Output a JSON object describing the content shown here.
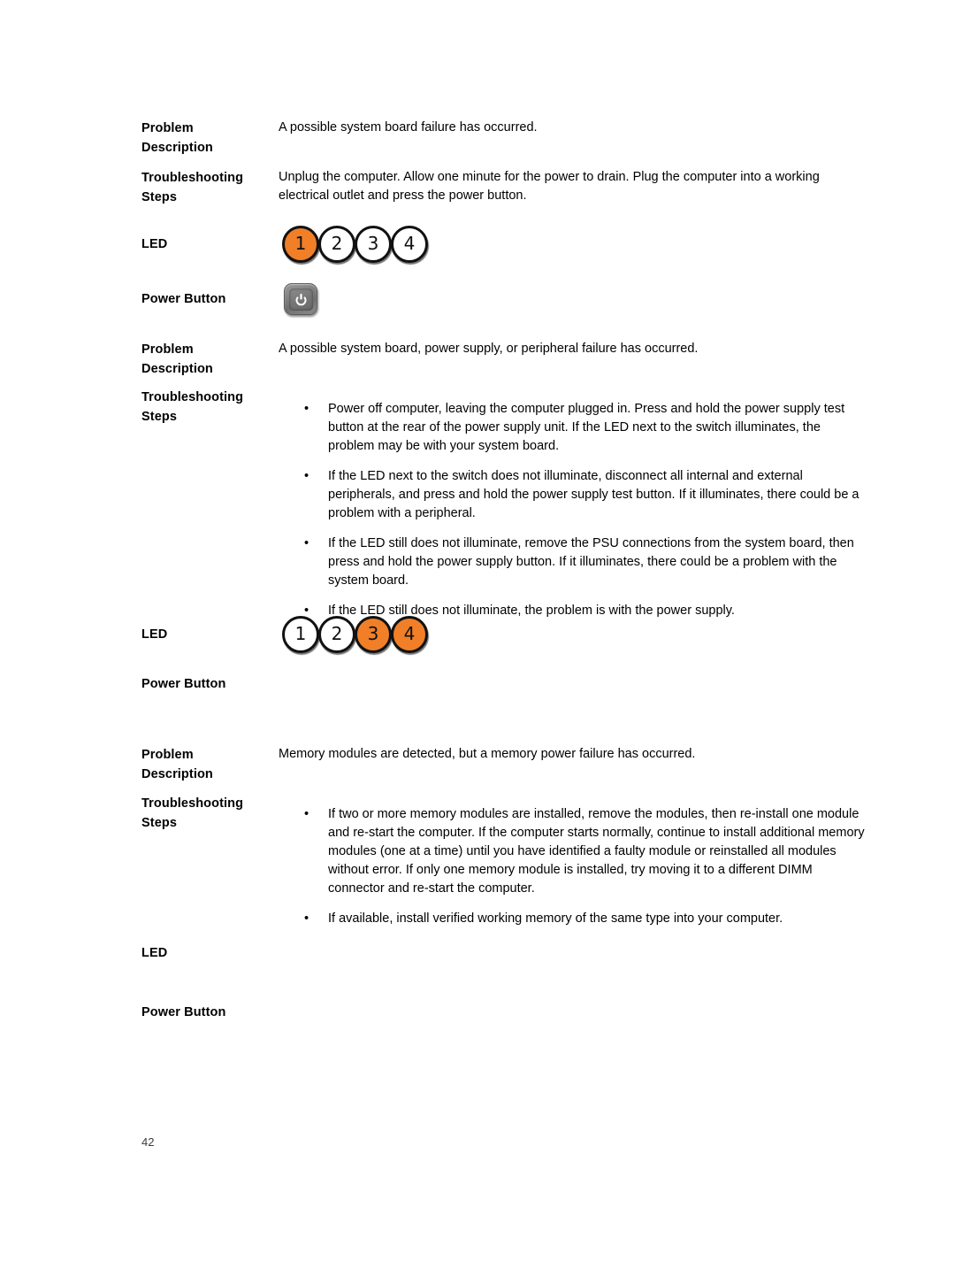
{
  "page": {
    "number": "42",
    "accent_orange": "#F07F28",
    "text_color": "#000000",
    "background": "#FFFFFF"
  },
  "labels": {
    "problem_description": "Problem\nDescription",
    "problem_line1": "Problem",
    "problem_line2": "Description",
    "troubleshooting_line1": "Troubleshooting",
    "troubleshooting_line2": "Steps",
    "led": "LED",
    "power_button": "Power Button"
  },
  "sections": [
    {
      "id": "section-1",
      "problem_description": "A possible system board failure has occurred.",
      "troubleshooting_paragraph": "Unplug the computer. Allow one minute for the power to drain. Plug the computer into a working electrical outlet and press the power button.",
      "troubleshooting_bullets": [],
      "led": {
        "bullet": "•",
        "lights": [
          {
            "number": "1",
            "state": "on"
          },
          {
            "number": "2",
            "state": "off"
          },
          {
            "number": "3",
            "state": "off"
          },
          {
            "number": "4",
            "state": "off"
          }
        ]
      },
      "power_button": {
        "icon": "power-button-icon",
        "visible": true
      }
    },
    {
      "id": "section-2",
      "problem_description": "A possible system board, power supply, or peripheral failure has occurred.",
      "troubleshooting_paragraph": "",
      "troubleshooting_bullets": [
        "Power off computer, leaving the computer plugged in. Press and hold the power supply test button at the rear of the power supply unit. If the LED next to the switch illuminates, the problem may be with your system board.",
        "If the LED next to the switch does not illuminate, disconnect all internal and external peripherals, and press and hold the power supply test button. If it illuminates, there could be a problem with a peripheral.",
        "If the LED still does not illuminate, remove the PSU connections from the system board, then press and hold the power supply button. If it illuminates, there could be a problem with the system board.",
        "If the LED still does not illuminate, the problem is with the power supply."
      ],
      "led": {
        "bullet": "•",
        "lights": [
          {
            "number": "1",
            "state": "off"
          },
          {
            "number": "2",
            "state": "off"
          },
          {
            "number": "3",
            "state": "on"
          },
          {
            "number": "4",
            "state": "on"
          }
        ]
      },
      "power_button": {
        "icon": "power-button-icon",
        "visible": false
      }
    },
    {
      "id": "section-3",
      "problem_description": "Memory modules are detected, but a memory power failure has occurred.",
      "troubleshooting_paragraph": "",
      "troubleshooting_bullets": [
        "If two or more memory modules are installed, remove the modules, then re-install one module and re-start the computer. If the computer starts normally, continue to install additional memory modules (one at a time) until you have identified a faulty module or reinstalled all modules without error. If only one memory module is installed, try moving it to a different DIMM connector and re-start the computer.",
        "If available, install verified working memory of the same type into your computer."
      ],
      "led": {
        "bullet": "•",
        "lights": []
      },
      "power_button": {
        "icon": "power-button-icon",
        "visible": false
      }
    }
  ],
  "bullet_char": "•"
}
